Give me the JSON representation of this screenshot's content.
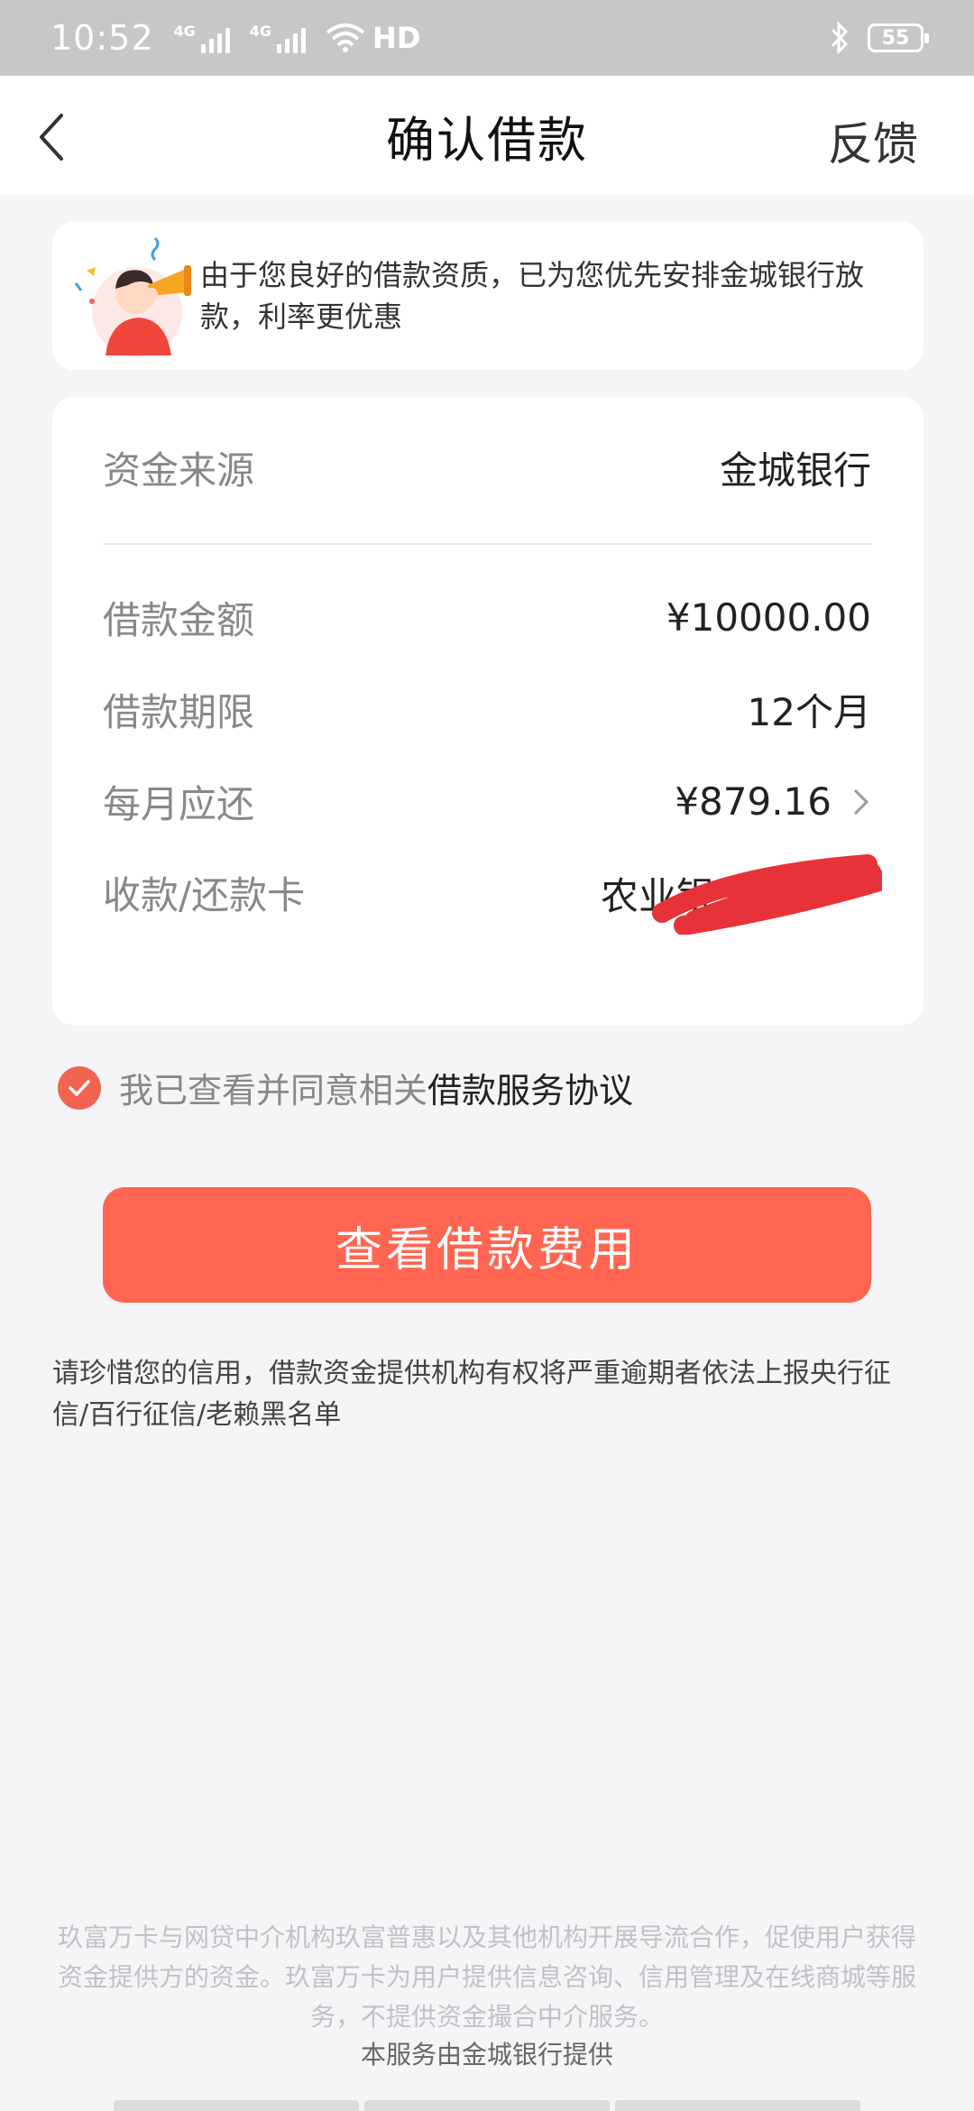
{
  "status_bar": {
    "time": "10:52",
    "network_1": "4G",
    "network_2": "4G",
    "hd": "HD",
    "battery": "55"
  },
  "nav": {
    "title": "确认借款",
    "feedback": "反馈"
  },
  "notice": {
    "text": "由于您良好的借款资质，已为您优先安排金城银行放款，利率更优惠"
  },
  "info": {
    "rows": [
      {
        "label": "资金来源",
        "value": "金城银行"
      },
      {
        "label": "借款金额",
        "value": "¥10000.00"
      },
      {
        "label": "借款期限",
        "value": "12个月"
      },
      {
        "label": "每月应还",
        "value": "¥879.16"
      },
      {
        "label": "收款/还款卡",
        "value": "农业银"
      }
    ]
  },
  "agreement": {
    "prefix": "我已查看并同意相关",
    "link": "借款服务协议"
  },
  "cta": {
    "label": "查看借款费用"
  },
  "warning": "请珍惜您的信用，借款资金提供机构有权将严重逾期者依法上报央行征信/百行征信/老赖黑名单",
  "footer": {
    "disclaimer": "玖富万卡与网贷中介机构玖富普惠以及其他机构开展导流合作，促使用户获得资金提供方的资金。玖富万卡为用户提供信息咨询、信用管理及在线商城等服务，不提供资金撮合中介服务。",
    "provider": "本服务由金城银行提供"
  },
  "colors": {
    "accent": "#ff6550",
    "status_bar": "#c7c7c7",
    "background": "#f5f5f8",
    "scribble": "#e8323a"
  }
}
